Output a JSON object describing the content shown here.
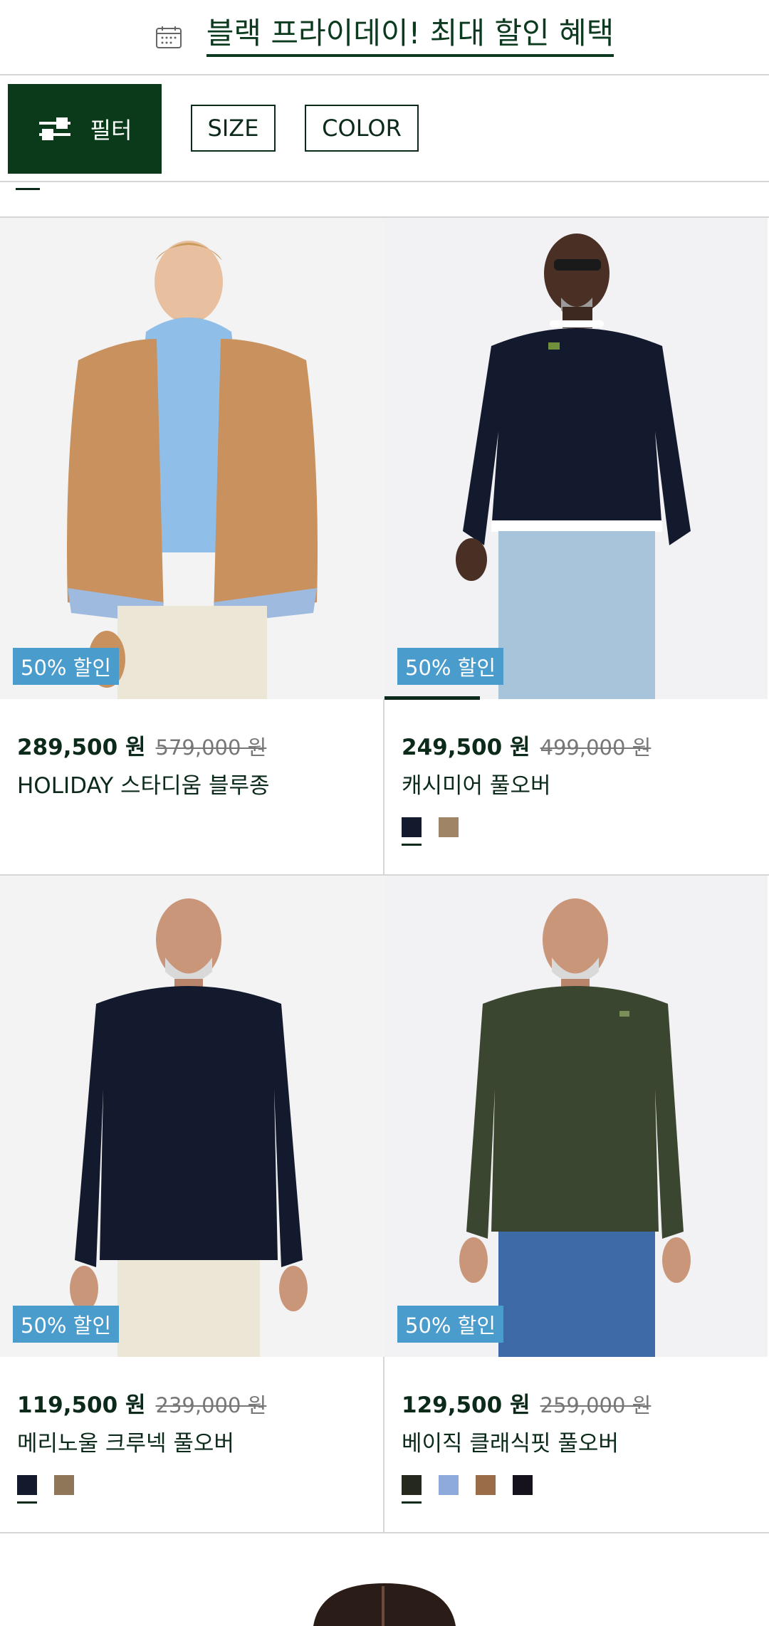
{
  "promo": {
    "icon": "calendar-icon",
    "text": "블랙 프라이데이! 최대 할인 혜택"
  },
  "filters": {
    "filter_label": "필터",
    "size_label": "SIZE",
    "color_label": "COLOR"
  },
  "products": [
    {
      "badge": "50% 할인",
      "price": "289,500 원",
      "original_price": "579,000 원",
      "name": "HOLIDAY 스타디움 블루종",
      "swatches": []
    },
    {
      "badge": "50% 할인",
      "price": "249,500 원",
      "original_price": "499,000 원",
      "name": "캐시미어 풀오버",
      "swatches": [
        "#141a2e",
        "#a08466"
      ],
      "image_progress": 0.25
    },
    {
      "badge": "50% 할인",
      "price": "119,500 원",
      "original_price": "239,000 원",
      "name": "메리노울 크루넥 풀오버",
      "swatches": [
        "#141a2e",
        "#8f7658"
      ]
    },
    {
      "badge": "50% 할인",
      "price": "129,500 원",
      "original_price": "259,000 원",
      "name": "베이직 클래식핏 풀오버",
      "swatches": [
        "#25291d",
        "#8eaadd",
        "#9a6d48",
        "#16121c"
      ]
    }
  ],
  "colors": {
    "brand_dark": "#0b3a1a",
    "badge_blue": "#4a9ccd",
    "divider": "#d6d6d6"
  }
}
